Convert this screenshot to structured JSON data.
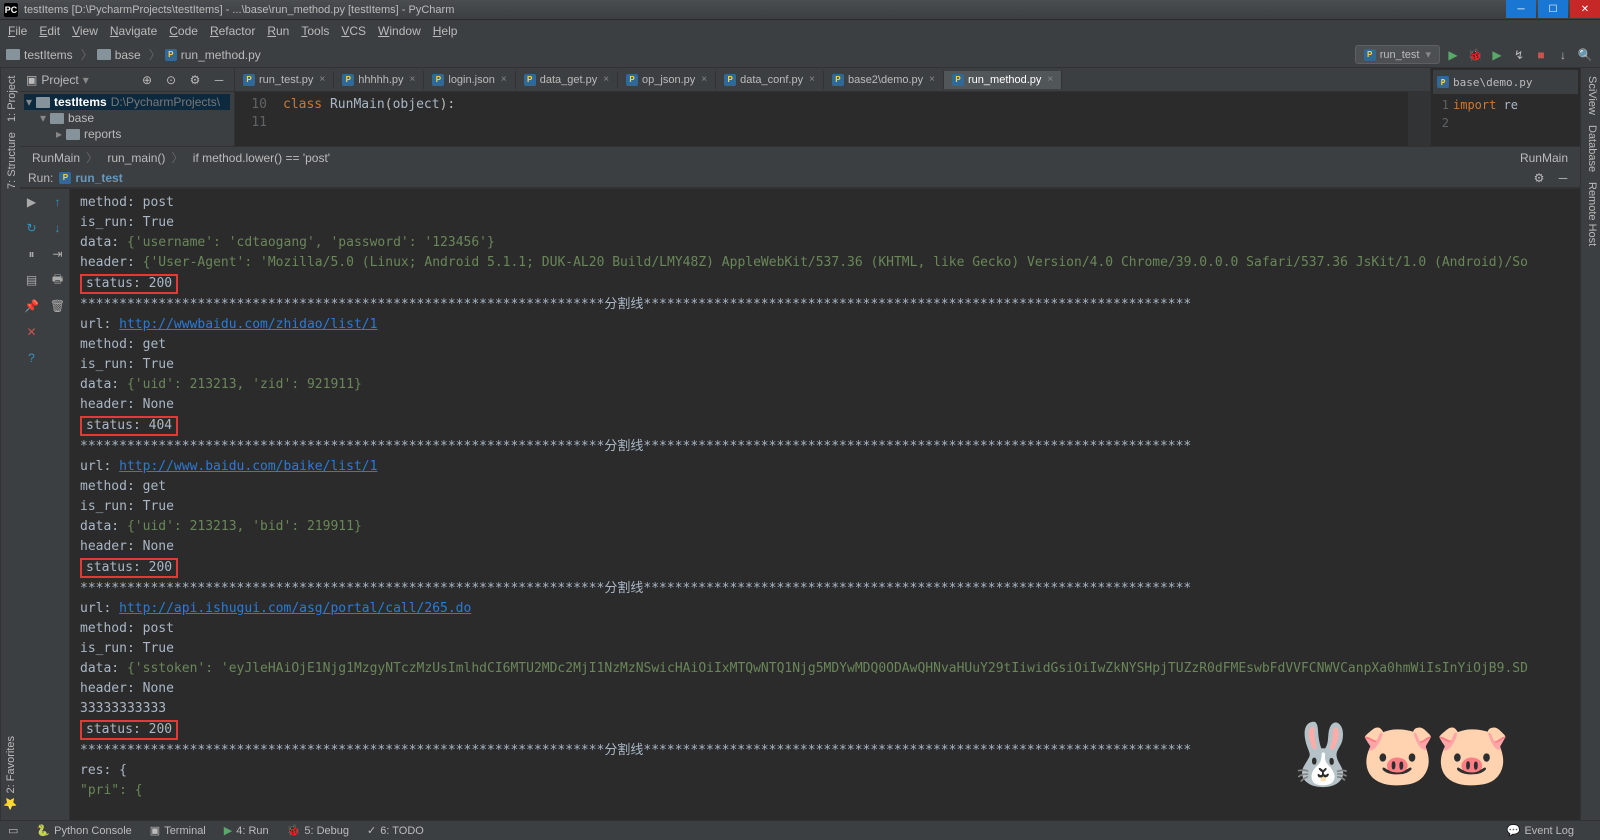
{
  "title": "testItems [D:\\PycharmProjects\\testItems] - ...\\base\\run_method.py [testItems] - PyCharm",
  "menubar": [
    "File",
    "Edit",
    "View",
    "Navigate",
    "Code",
    "Refactor",
    "Run",
    "Tools",
    "VCS",
    "Window",
    "Help"
  ],
  "nav": {
    "crumbs": [
      "testItems",
      "base",
      "run_method.py"
    ],
    "run_config": "run_test"
  },
  "project": {
    "header": "Project",
    "root": {
      "name": "testItems",
      "path": "D:\\PycharmProjects\\"
    },
    "children": [
      {
        "name": "base",
        "children": [
          {
            "name": "reports"
          }
        ]
      }
    ]
  },
  "editor": {
    "tabs": [
      {
        "label": "run_test.py",
        "icon": "py"
      },
      {
        "label": "hhhhh.py",
        "icon": "py"
      },
      {
        "label": "login.json",
        "icon": "json"
      },
      {
        "label": "data_get.py",
        "icon": "py"
      },
      {
        "label": "op_json.py",
        "icon": "py"
      },
      {
        "label": "data_conf.py",
        "icon": "py"
      },
      {
        "label": "base2\\demo.py",
        "icon": "py"
      },
      {
        "label": "run_method.py",
        "icon": "py",
        "active": true
      }
    ],
    "side_tab": "base\\demo.py",
    "line_start": 10,
    "code_line_10": "class RunMain(object):",
    "side_code_line_1": "import re",
    "breadcrumb": [
      "RunMain",
      "run_main()",
      "if method.lower() == 'post'"
    ],
    "breadcrumb_right": "RunMain"
  },
  "run": {
    "title_prefix": "Run:",
    "config_name": "run_test",
    "lines": [
      {
        "t": "plain",
        "text": "method: post"
      },
      {
        "t": "plain",
        "text": "is_run: True"
      },
      {
        "t": "data",
        "prefix": "data: ",
        "content": "{'username': 'cdtaogang', 'password': '123456'}"
      },
      {
        "t": "data",
        "prefix": "header: ",
        "content": "{'User-Agent': 'Mozilla/5.0 (Linux; Android 5.1.1; DUK-AL20 Build/LMY48Z) AppleWebKit/537.36 (KHTML, like Gecko) Version/4.0 Chrome/39.0.0.0 Safari/537.36 JsKit/1.0 (Android)/So"
      },
      {
        "t": "hl",
        "text": "status: 200"
      },
      {
        "t": "sep",
        "text": "*******************************************************************分割线**********************************************************************"
      },
      {
        "t": "url",
        "prefix": "url: ",
        "url": "http://wwwbaidu.com/zhidao/list/1"
      },
      {
        "t": "plain",
        "text": "method: get"
      },
      {
        "t": "plain",
        "text": "is_run: True"
      },
      {
        "t": "data",
        "prefix": "data: ",
        "content": "{'uid': 213213, 'zid': 921911}"
      },
      {
        "t": "plain",
        "text": "header: None"
      },
      {
        "t": "hl",
        "text": "status: 404"
      },
      {
        "t": "sep",
        "text": "*******************************************************************分割线**********************************************************************"
      },
      {
        "t": "url",
        "prefix": "url: ",
        "url": "http://www.baidu.com/baike/list/1"
      },
      {
        "t": "plain",
        "text": "method: get"
      },
      {
        "t": "plain",
        "text": "is_run: True"
      },
      {
        "t": "data",
        "prefix": "data: ",
        "content": "{'uid': 213213, 'bid': 219911}"
      },
      {
        "t": "plain",
        "text": "header: None"
      },
      {
        "t": "hl",
        "text": "status: 200"
      },
      {
        "t": "sep",
        "text": "*******************************************************************分割线**********************************************************************"
      },
      {
        "t": "url",
        "prefix": "url: ",
        "url": "http://api.ishugui.com/asg/portal/call/265.do"
      },
      {
        "t": "plain",
        "text": "method: post"
      },
      {
        "t": "plain",
        "text": "is_run: True"
      },
      {
        "t": "data",
        "prefix": "data: ",
        "content": "{'sstoken': 'eyJleHAiOjE1Njg1MzgyNTczMzUsImlhdCI6MTU2MDc2MjI1NzMzNSwicHAiOiIxMTQwNTQ1Njg5MDYwMDQ0ODAwQHNvaHUuY29tIiwidGsiOiIwZkNYSHpjTUZzR0dFMEswbFdVVFCNWVCanpXa0hmWiIsInYiOjB9.SD"
      },
      {
        "t": "plain",
        "text": "header: None"
      },
      {
        "t": "plain",
        "text": "33333333333"
      },
      {
        "t": "hl",
        "text": "status: 200"
      },
      {
        "t": "sep",
        "text": "*******************************************************************分割线**********************************************************************"
      },
      {
        "t": "plain",
        "text": "res: {"
      },
      {
        "t": "data",
        "prefix": "    ",
        "content": "\"pri\": {"
      }
    ]
  },
  "statusbar": {
    "items": [
      "Python Console",
      "Terminal",
      "4: Run",
      "5: Debug",
      "6: TODO"
    ],
    "right": "Event Log"
  },
  "side_tabs_left": [
    "1: Project",
    "7: Structure"
  ],
  "side_tabs_left_bottom": "2: Favorites",
  "side_tabs_right": [
    "SciView",
    "Database",
    "Remote Host"
  ]
}
